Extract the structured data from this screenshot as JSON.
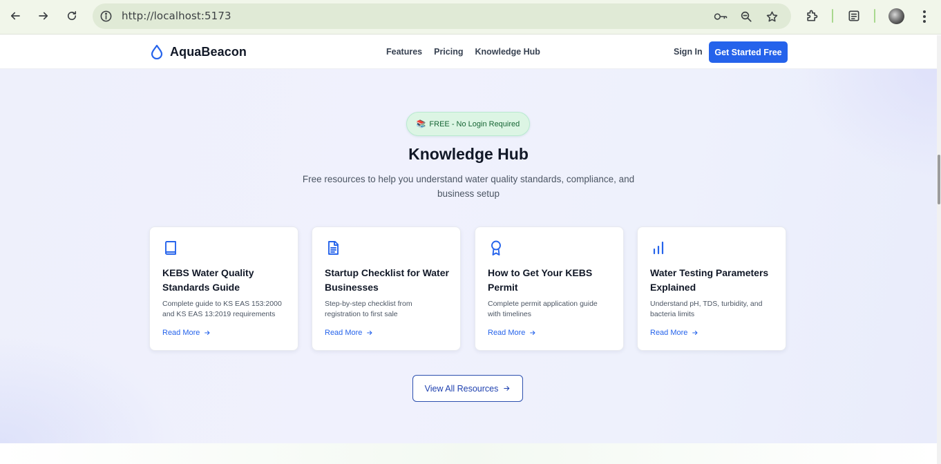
{
  "browser": {
    "url": "http://localhost:5173",
    "icons": [
      "back-icon",
      "forward-icon",
      "reload-icon",
      "site-info-icon",
      "key-icon",
      "zoom-icon",
      "star-icon",
      "extensions-icon",
      "reading-list-icon",
      "profile-avatar",
      "menu-icon"
    ]
  },
  "header": {
    "brand": "AquaBeacon",
    "nav": [
      "Features",
      "Pricing",
      "Knowledge Hub"
    ],
    "sign_in": "Sign In",
    "cta": "Get Started Free"
  },
  "hero": {
    "badge_emoji": "📚",
    "badge": "FREE - No Login Required",
    "title": "Knowledge Hub",
    "subtitle": "Free resources to help you understand water quality standards, compliance, and business setup"
  },
  "cards": [
    {
      "icon": "book-icon",
      "title": "KEBS Water Quality Standards Guide",
      "description": "Complete guide to KS EAS 153:2000 and KS EAS 13:2019 requirements",
      "link": "Read More"
    },
    {
      "icon": "document-icon",
      "title": "Startup Checklist for Water Businesses",
      "description": "Step-by-step checklist from registration to first sale",
      "link": "Read More"
    },
    {
      "icon": "award-icon",
      "title": "How to Get Your KEBS Permit",
      "description": "Complete permit application guide with timelines",
      "link": "Read More"
    },
    {
      "icon": "bar-chart-icon",
      "title": "Water Testing Parameters Explained",
      "description": "Understand pH, TDS, turbidity, and bacteria limits",
      "link": "Read More"
    }
  ],
  "view_all": "View All Resources",
  "colors": {
    "accent": "#2563eb",
    "badge_bg": "#dcf5e4",
    "badge_text": "#166534",
    "hero_bg": "#eef0fb",
    "browser_chrome": "#f1f6ea"
  }
}
